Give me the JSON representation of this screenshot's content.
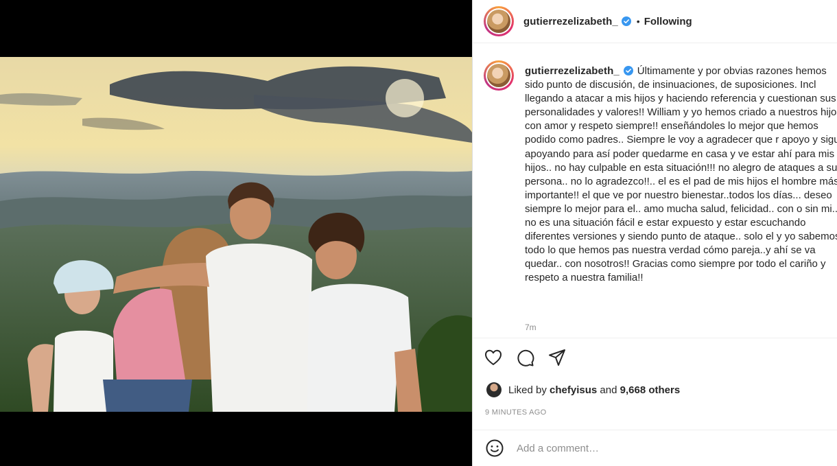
{
  "post": {
    "username": "gutierrezelizabeth_",
    "follow_status": "Following",
    "separator": "•",
    "caption": "Últimamente y por obvias razones hemos sido punto de discusión, de insinuaciones, de suposiciones. Incl llegando a atacar a mis hijos y haciendo referencia y cuestionan sus personalidades y valores!! William y yo hemos criado a nuestros hijos con amor y respeto siempre!! enseñándoles lo mejor que hemos podido como padres.. Siempre le voy a agradecer que r apoyo y sigue apoyando para así poder quedarme en casa y ve estar ahí para mis hijos.. no hay culpable en esta situación!!! no alegro de ataques a su persona.. no lo agradezco!!.. el es el pad de mis hijos el hombre más importante!! el que ve por nuestro bienestar..todos los días... deseo siempre lo mejor para el.. amo mucha salud, felicidad.. con o sin mi.. no es una situación fácil e estar expuesto y estar escuchando diferentes versiones y siendo punto de ataque.. solo el y yo sabemos todo lo que hemos pas nuestra verdad cómo pareja..y ahí se va quedar.. con nosotros!! Gracias como siempre por todo el cariño y respeto a nuestra familia!!",
    "caption_time": "7m",
    "liked_by_prefix": "Liked by",
    "liked_by_user": "chefyisus",
    "liked_by_and": "and",
    "liked_by_others": "9,668 others",
    "posted_ago": "9 MINUTES AGO",
    "comment_placeholder": "Add a comment…"
  },
  "colors": {
    "accent_verified": "#3897f0",
    "text_primary": "#262626",
    "text_secondary": "#8e8e8e"
  },
  "icons": [
    "heart-icon",
    "comment-icon",
    "share-icon",
    "emoji-icon",
    "verified-badge-icon"
  ]
}
